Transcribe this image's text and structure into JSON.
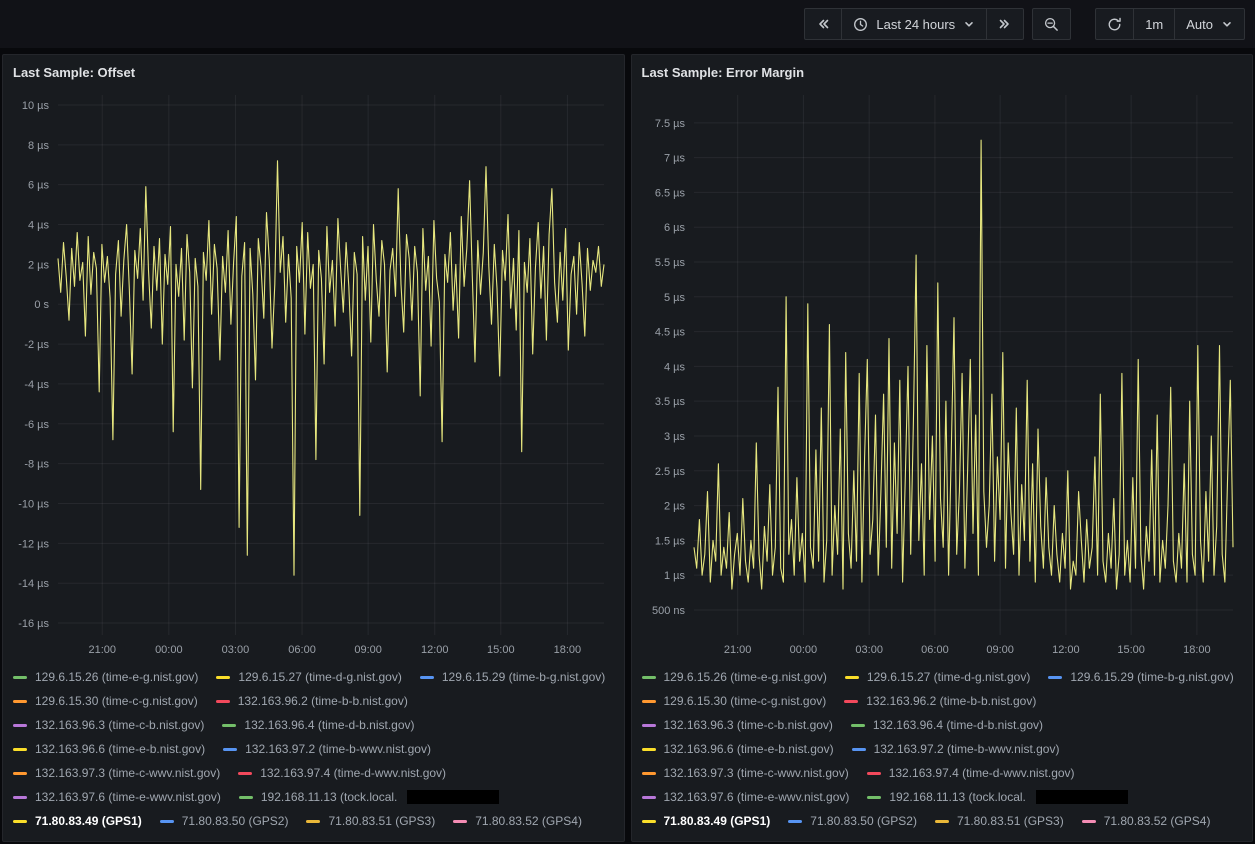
{
  "toolbar": {
    "time_range_label": "Last 24 hours",
    "refresh_interval": "1m",
    "auto_label": "Auto"
  },
  "legend_items": [
    {
      "label": "129.6.15.26 (time-e-g.nist.gov)",
      "color": "#73BF69"
    },
    {
      "label": "129.6.15.27 (time-d-g.nist.gov)",
      "color": "#FADE2A"
    },
    {
      "label": "129.6.15.29 (time-b-g.nist.gov)",
      "color": "#5794F2"
    },
    {
      "label": "129.6.15.30 (time-c-g.nist.gov)",
      "color": "#FF9830"
    },
    {
      "label": "132.163.96.2 (time-b-b.nist.gov)",
      "color": "#F2495C"
    },
    {
      "label": "132.163.96.3 (time-c-b.nist.gov)",
      "color": "#B877D9"
    },
    {
      "label": "132.163.96.4 (time-d-b.nist.gov)",
      "color": "#73BF69"
    },
    {
      "label": "132.163.96.6 (time-e-b.nist.gov)",
      "color": "#FADE2A"
    },
    {
      "label": "132.163.97.2 (time-b-wwv.nist.gov)",
      "color": "#5794F2"
    },
    {
      "label": "132.163.97.3 (time-c-wwv.nist.gov)",
      "color": "#FF9830"
    },
    {
      "label": "132.163.97.4 (time-d-wwv.nist.gov)",
      "color": "#F2495C"
    },
    {
      "label": "132.163.97.6 (time-e-wwv.nist.gov)",
      "color": "#B877D9"
    },
    {
      "label": "192.168.11.13 (tock.local.",
      "color": "#73BF69",
      "redacted": true
    },
    {
      "label": "71.80.83.49 (GPS1)",
      "color": "#FADE2A",
      "selected": true
    },
    {
      "label": "71.80.83.50 (GPS2)",
      "color": "#5794F2"
    },
    {
      "label": "71.80.83.51 (GPS3)",
      "color": "#EAB839"
    },
    {
      "label": "71.80.83.52 (GPS4)",
      "color": "#F48CB4"
    }
  ],
  "panels": [
    {
      "title": "Last Sample: Offset",
      "chart_data": {
        "type": "line",
        "series_name": "71.80.83.49 (GPS1)",
        "line_color": "#E7E77F",
        "margin_left": 45,
        "ylim": [
          -16.6,
          10.5
        ],
        "yticks": [
          {
            "label": "10 µs",
            "v": 10
          },
          {
            "label": "8 µs",
            "v": 8
          },
          {
            "label": "6 µs",
            "v": 6
          },
          {
            "label": "4 µs",
            "v": 4
          },
          {
            "label": "2 µs",
            "v": 2
          },
          {
            "label": "0 s",
            "v": 0
          },
          {
            "label": "-2 µs",
            "v": -2
          },
          {
            "label": "-4 µs",
            "v": -4
          },
          {
            "label": "-6 µs",
            "v": -6
          },
          {
            "label": "-8 µs",
            "v": -8
          },
          {
            "label": "-10 µs",
            "v": -10
          },
          {
            "label": "-12 µs",
            "v": -12
          },
          {
            "label": "-14 µs",
            "v": -14
          },
          {
            "label": "-16 µs",
            "v": -16
          }
        ],
        "xticks": [
          {
            "label": "21:00",
            "f": 0.081
          },
          {
            "label": "00:00",
            "f": 0.203
          },
          {
            "label": "03:00",
            "f": 0.325
          },
          {
            "label": "06:00",
            "f": 0.447
          },
          {
            "label": "09:00",
            "f": 0.568
          },
          {
            "label": "12:00",
            "f": 0.69
          },
          {
            "label": "15:00",
            "f": 0.811
          },
          {
            "label": "18:00",
            "f": 0.933
          }
        ],
        "points": [
          2.3,
          0.6,
          3.1,
          1.4,
          -0.8,
          2.8,
          0.9,
          3.6,
          1.2,
          2.1,
          -1.6,
          3.4,
          0.5,
          2.6,
          1.8,
          -4.4,
          3.0,
          1.1,
          2.4,
          0.3,
          -6.8,
          1.5,
          3.2,
          -0.6,
          2.2,
          4.0,
          0.8,
          -3.5,
          2.7,
          1.3,
          3.8,
          0.2,
          5.9,
          1.7,
          -1.2,
          2.9,
          0.7,
          3.3,
          -2.0,
          2.5,
          1.0,
          3.9,
          -6.4,
          2.0,
          0.4,
          2.8,
          -1.8,
          3.5,
          1.6,
          -4.2,
          2.3,
          0.9,
          -9.3,
          2.6,
          1.2,
          4.2,
          -0.5,
          3.0,
          1.8,
          -2.8,
          2.4,
          0.6,
          3.7,
          -1.0,
          2.1,
          4.4,
          -11.2,
          1.4,
          3.1,
          -12.6,
          2.8,
          0.5,
          -3.8,
          3.3,
          1.9,
          -0.7,
          4.6,
          2.2,
          -2.2,
          1.0,
          7.2,
          1.6,
          3.4,
          -0.9,
          2.5,
          0.3,
          -13.6,
          2.9,
          1.1,
          4.1,
          -1.5,
          3.6,
          0.8,
          2.0,
          -7.8,
          2.7,
          1.3,
          -3.0,
          3.9,
          0.6,
          2.2,
          -1.1,
          4.3,
          1.8,
          -0.4,
          3.1,
          0.9,
          -2.6,
          2.6,
          1.5,
          -10.6,
          3.4,
          0.2,
          2.9,
          -1.9,
          4.0,
          1.2,
          -0.6,
          3.2,
          2.0,
          -3.4,
          1.7,
          2.8,
          0.4,
          5.8,
          1.0,
          -1.4,
          3.5,
          2.3,
          -0.8,
          2.9,
          1.6,
          -4.6,
          3.8,
          0.7,
          2.4,
          -2.1,
          4.2,
          1.3,
          0.1,
          -6.9,
          2.5,
          1.1,
          3.6,
          -0.3,
          2.0,
          -1.7,
          4.4,
          0.9,
          2.8,
          6.2,
          1.4,
          -2.9,
          3.2,
          0.5,
          2.6,
          6.9,
          1.9,
          -1.0,
          3.0,
          0.8,
          -3.6,
          2.7,
          1.2,
          4.5,
          -0.2,
          2.3,
          -1.3,
          3.7,
          -7.4,
          2.1,
          0.6,
          3.3,
          -2.5,
          1.8,
          4.1,
          0.3,
          2.9,
          -1.8,
          3.5,
          5.8,
          1.1,
          -0.9,
          2.6,
          0.2,
          3.8,
          -2.3,
          1.5,
          2.4,
          -0.5,
          3.1,
          1.0,
          -1.6,
          2.8,
          0.7,
          2.2,
          1.6,
          2.9,
          0.9,
          2.0
        ]
      }
    },
    {
      "title": "Last Sample: Error Margin",
      "chart_data": {
        "type": "line",
        "series_name": "71.80.83.49 (GPS1)",
        "line_color": "#E7E77F",
        "margin_left": 52,
        "ylim": [
          0.14,
          7.9
        ],
        "yticks": [
          {
            "label": "7.5 µs",
            "v": 7.5
          },
          {
            "label": "7 µs",
            "v": 7
          },
          {
            "label": "6.5 µs",
            "v": 6.5
          },
          {
            "label": "6 µs",
            "v": 6
          },
          {
            "label": "5.5 µs",
            "v": 5.5
          },
          {
            "label": "5 µs",
            "v": 5
          },
          {
            "label": "4.5 µs",
            "v": 4.5
          },
          {
            "label": "4 µs",
            "v": 4
          },
          {
            "label": "3.5 µs",
            "v": 3.5
          },
          {
            "label": "3 µs",
            "v": 3
          },
          {
            "label": "2.5 µs",
            "v": 2.5
          },
          {
            "label": "2 µs",
            "v": 2
          },
          {
            "label": "1.5 µs",
            "v": 1.5
          },
          {
            "label": "1 µs",
            "v": 1
          },
          {
            "label": "500 ns",
            "v": 0.5
          }
        ],
        "xticks": [
          {
            "label": "21:00",
            "f": 0.081
          },
          {
            "label": "00:00",
            "f": 0.203
          },
          {
            "label": "03:00",
            "f": 0.325
          },
          {
            "label": "06:00",
            "f": 0.447
          },
          {
            "label": "09:00",
            "f": 0.568
          },
          {
            "label": "12:00",
            "f": 0.69
          },
          {
            "label": "15:00",
            "f": 0.811
          },
          {
            "label": "18:00",
            "f": 0.933
          }
        ],
        "points": [
          1.4,
          1.1,
          1.8,
          1.0,
          1.3,
          2.2,
          0.9,
          1.5,
          1.2,
          2.6,
          1.0,
          1.4,
          1.1,
          1.9,
          0.8,
          1.3,
          1.6,
          1.0,
          2.1,
          1.2,
          0.9,
          1.5,
          1.1,
          2.9,
          1.3,
          0.8,
          1.7,
          1.2,
          2.3,
          1.0,
          1.4,
          3.7,
          1.1,
          0.9,
          5.0,
          1.3,
          1.8,
          1.0,
          2.4,
          1.2,
          1.6,
          0.9,
          4.9,
          1.4,
          1.1,
          2.8,
          1.2,
          3.4,
          0.9,
          1.5,
          4.6,
          1.0,
          2.0,
          1.3,
          3.1,
          0.8,
          4.2,
          1.6,
          1.1,
          2.5,
          1.2,
          3.9,
          0.9,
          2.7,
          4.1,
          1.3,
          1.8,
          3.3,
          1.0,
          2.2,
          3.6,
          1.4,
          4.4,
          1.1,
          2.9,
          1.6,
          3.8,
          0.9,
          2.4,
          4.0,
          1.3,
          3.2,
          5.6,
          1.5,
          2.6,
          1.0,
          4.3,
          1.8,
          3.0,
          1.2,
          5.2,
          2.1,
          1.4,
          3.5,
          1.0,
          2.8,
          4.7,
          1.3,
          2.2,
          3.9,
          1.1,
          2.5,
          4.1,
          1.6,
          3.3,
          1.0,
          7.25,
          2.2,
          1.4,
          2.0,
          3.6,
          1.2,
          2.7,
          1.8,
          4.2,
          1.1,
          2.9,
          1.9,
          1.3,
          3.4,
          1.0,
          2.3,
          1.5,
          3.8,
          1.2,
          2.6,
          0.9,
          3.1,
          1.7,
          1.1,
          2.4,
          1.4,
          1.0,
          2.0,
          1.3,
          0.9,
          1.6,
          1.1,
          2.5,
          0.8,
          1.2,
          1.0,
          2.2,
          1.5,
          0.9,
          1.8,
          1.1,
          1.4,
          2.7,
          1.0,
          3.6,
          1.2,
          0.9,
          1.6,
          1.1,
          2.1,
          0.8,
          1.3,
          3.9,
          1.0,
          1.5,
          0.9,
          2.4,
          1.1,
          4.1,
          1.3,
          0.8,
          1.7,
          1.2,
          2.8,
          1.0,
          3.3,
          0.9,
          1.5,
          1.1,
          2.0,
          3.7,
          1.2,
          0.9,
          1.6,
          1.1,
          2.6,
          0.9,
          3.5,
          1.3,
          1.0,
          4.3,
          1.5,
          0.9,
          2.2,
          1.2,
          3.0,
          1.0,
          1.7,
          4.3,
          1.3,
          0.9,
          2.4,
          3.8,
          1.4
        ]
      }
    }
  ]
}
